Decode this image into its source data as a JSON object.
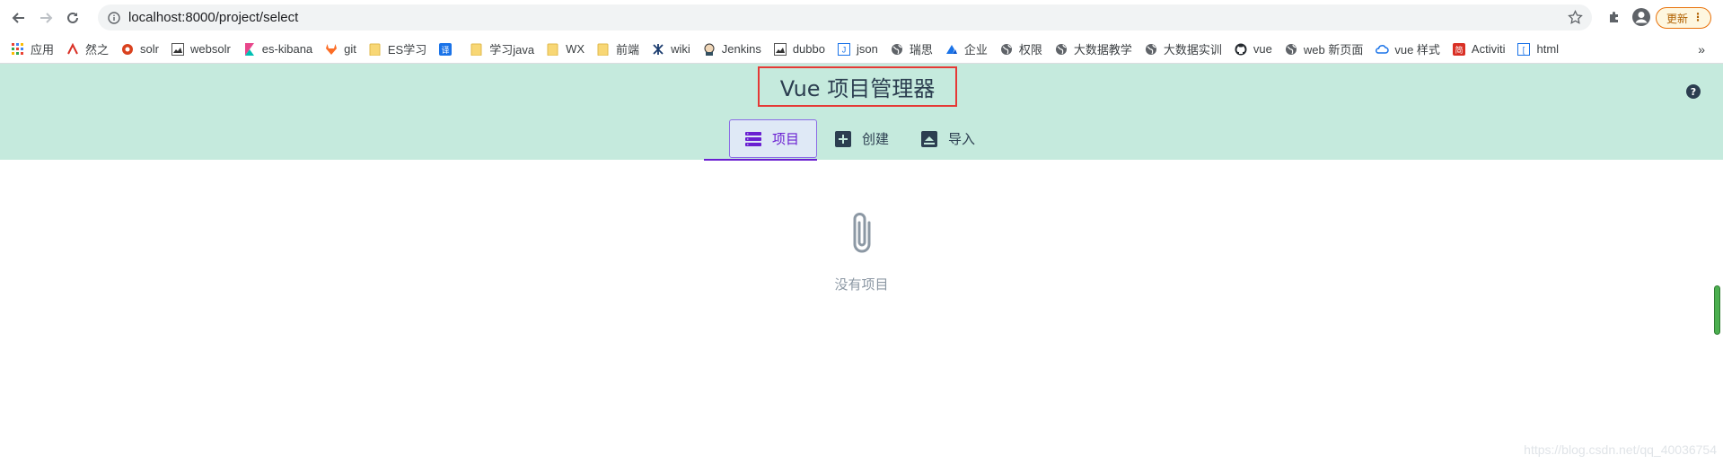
{
  "browser": {
    "url": "localhost:8000/project/select",
    "update_label": "更新",
    "more_bookmarks": "»"
  },
  "bookmarks": [
    {
      "label": "应用",
      "icon": "apps-grid-icon"
    },
    {
      "label": "然之",
      "icon": "ranzhi-icon"
    },
    {
      "label": "solr",
      "icon": "solr-icon"
    },
    {
      "label": "websolr",
      "icon": "image-icon"
    },
    {
      "label": "es-kibana",
      "icon": "kibana-icon"
    },
    {
      "label": "git",
      "icon": "gitlab-icon"
    },
    {
      "label": "ES学习",
      "icon": "folder-icon"
    },
    {
      "label": "",
      "icon": "translate-icon"
    },
    {
      "label": "学习java",
      "icon": "folder-icon"
    },
    {
      "label": "WX",
      "icon": "folder-icon"
    },
    {
      "label": "前端",
      "icon": "folder-icon"
    },
    {
      "label": "wiki",
      "icon": "wiki-icon"
    },
    {
      "label": "Jenkins",
      "icon": "jenkins-icon"
    },
    {
      "label": "dubbo",
      "icon": "image-icon"
    },
    {
      "label": "json",
      "icon": "json-icon"
    },
    {
      "label": "瑞思",
      "icon": "globe-icon"
    },
    {
      "label": "企业",
      "icon": "enterprise-icon"
    },
    {
      "label": "权限",
      "icon": "globe-icon"
    },
    {
      "label": "大数据教学",
      "icon": "globe-icon"
    },
    {
      "label": "大数据实训",
      "icon": "globe-icon"
    },
    {
      "label": "vue",
      "icon": "github-icon"
    },
    {
      "label": "web 新页面",
      "icon": "globe-icon"
    },
    {
      "label": "vue 样式",
      "icon": "cloud-icon"
    },
    {
      "label": "Activiti",
      "icon": "activiti-icon"
    },
    {
      "label": "html",
      "icon": "html-icon"
    }
  ],
  "app": {
    "title": "Vue 项目管理器",
    "help": "?",
    "tabs": [
      {
        "label": "项目",
        "icon": "list-icon",
        "active": true
      },
      {
        "label": "创建",
        "icon": "plus-square-icon",
        "active": false
      },
      {
        "label": "导入",
        "icon": "import-icon",
        "active": false
      }
    ],
    "empty_text": "没有项目",
    "empty_icon": "paperclip-icon"
  },
  "watermark": "https://blog.csdn.net/qq_40036754",
  "colors": {
    "header_bg": "#c5eadd",
    "accent": "#6a1fd1",
    "highlight_border": "#e53935"
  }
}
